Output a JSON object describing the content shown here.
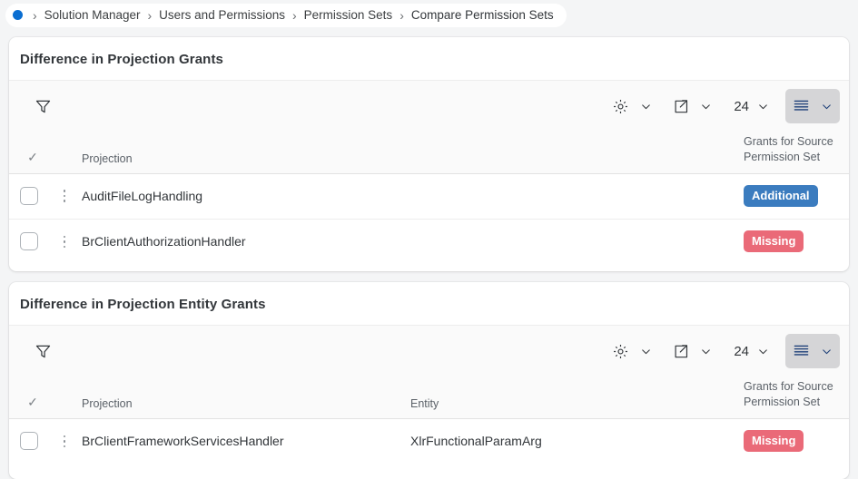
{
  "breadcrumb": {
    "dot_icon": "status-dot-icon",
    "separator": "›",
    "items": [
      {
        "label": "Solution Manager"
      },
      {
        "label": "Users and Permissions"
      },
      {
        "label": "Permission Sets"
      },
      {
        "label": "Compare Permission Sets"
      }
    ]
  },
  "colors": {
    "accent_blue": "#0a6ed1",
    "badge_additional": "#3b7cbf",
    "badge_missing": "#ea6a78",
    "page_background": "#f4f5f6",
    "card_background": "#ffffff",
    "toolbar_background": "#fafafa",
    "active_button_background": "#d5d5d7"
  },
  "cards": [
    {
      "title": "Difference in Projection Grants",
      "toolbar": {
        "filter_icon": "filter-funnel-icon",
        "settings_icon": "gear-icon",
        "settings_chevron": "chevron-down-icon",
        "export_icon": "export-share-icon",
        "export_chevron": "chevron-down-icon",
        "count_label": "24",
        "count_chevron": "chevron-down-icon",
        "view_icon": "list-lines-icon",
        "view_chevron": "chevron-down-icon"
      },
      "columns": [
        {
          "key": "select",
          "label": "✓"
        },
        {
          "key": "menu",
          "label": ""
        },
        {
          "key": "projection",
          "label": "Projection"
        },
        {
          "key": "grants",
          "label": "Grants for Source Permission Set"
        }
      ],
      "rows": [
        {
          "projection": "AuditFileLogHandling",
          "grant_status": "Additional",
          "grant_status_kind": "additional"
        },
        {
          "projection": "BrClientAuthorizationHandler",
          "grant_status": "Missing",
          "grant_status_kind": "missing"
        }
      ]
    },
    {
      "title": "Difference in Projection Entity Grants",
      "toolbar": {
        "filter_icon": "filter-funnel-icon",
        "settings_icon": "gear-icon",
        "settings_chevron": "chevron-down-icon",
        "export_icon": "export-share-icon",
        "export_chevron": "chevron-down-icon",
        "count_label": "24",
        "count_chevron": "chevron-down-icon",
        "view_icon": "list-lines-icon",
        "view_chevron": "chevron-down-icon"
      },
      "columns": [
        {
          "key": "select",
          "label": "✓"
        },
        {
          "key": "menu",
          "label": ""
        },
        {
          "key": "projection",
          "label": "Projection"
        },
        {
          "key": "entity",
          "label": "Entity"
        },
        {
          "key": "grants",
          "label": "Grants for Source Permission Set"
        }
      ],
      "rows": [
        {
          "projection": "BrClientFrameworkServicesHandler",
          "entity": "XlrFunctionalParamArg",
          "grant_status": "Missing",
          "grant_status_kind": "missing"
        }
      ]
    }
  ]
}
